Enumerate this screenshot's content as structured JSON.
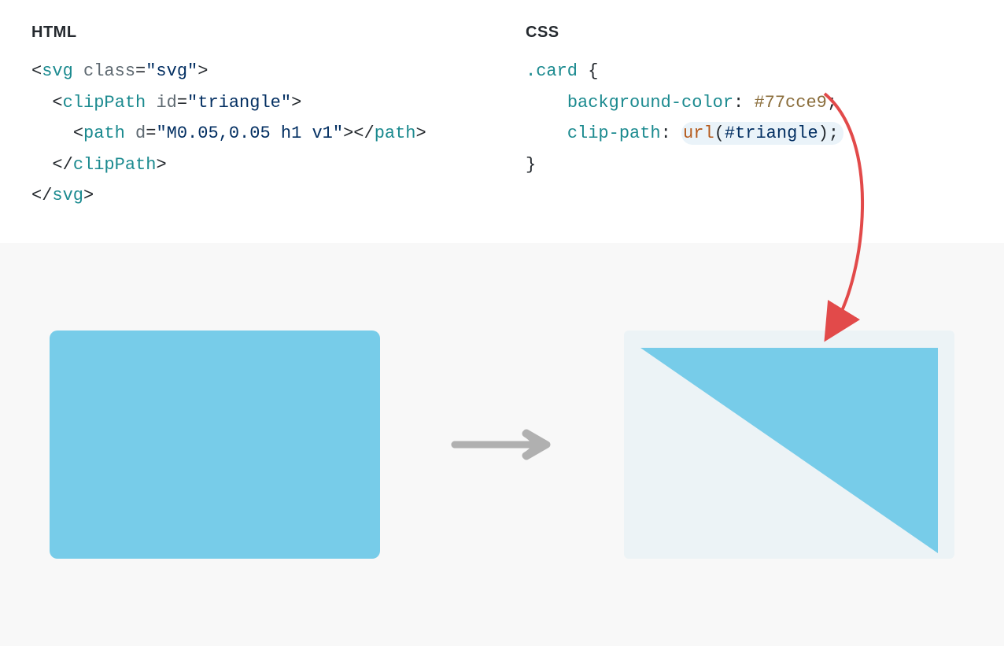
{
  "headings": {
    "html": "HTML",
    "css": "CSS"
  },
  "html_code": {
    "line1_open": "<",
    "line1_tag": "svg",
    "line1_sp": " ",
    "line1_attr": "class",
    "line1_eq": "=",
    "line1_val": "\"svg\"",
    "line1_close": ">",
    "line2_open": "<",
    "line2_tag": "clipPath",
    "line2_sp": " ",
    "line2_attr": "id",
    "line2_eq": "=",
    "line2_val": "\"triangle\"",
    "line2_close": ">",
    "line3_open": "<",
    "line3_tag": "path",
    "line3_sp": " ",
    "line3_attr": "d",
    "line3_eq": "=",
    "line3_val": "\"M0.05,0.05 h1 v1\"",
    "line3_close1": ">",
    "line3_close2": "</",
    "line3_tag2": "path",
    "line3_close3": ">",
    "line4_open": "</",
    "line4_tag": "clipPath",
    "line4_close": ">",
    "line5_open": "</",
    "line5_tag": "svg",
    "line5_close": ">"
  },
  "css_code": {
    "selector": ".card",
    "brace_open": " {",
    "prop1": "background-color",
    "colon": ": ",
    "val1": "#77cce9",
    "semi": ";",
    "prop2": "clip-path",
    "fn": "url",
    "paren_open": "(",
    "arg": "#triangle",
    "paren_close": ")",
    "brace_close": "}"
  },
  "colors": {
    "card_bg": "#77cce9",
    "panel_bg": "#ecf3f6",
    "arrow_red": "#e24a4a",
    "arrow_grey": "#b0b0b0"
  }
}
